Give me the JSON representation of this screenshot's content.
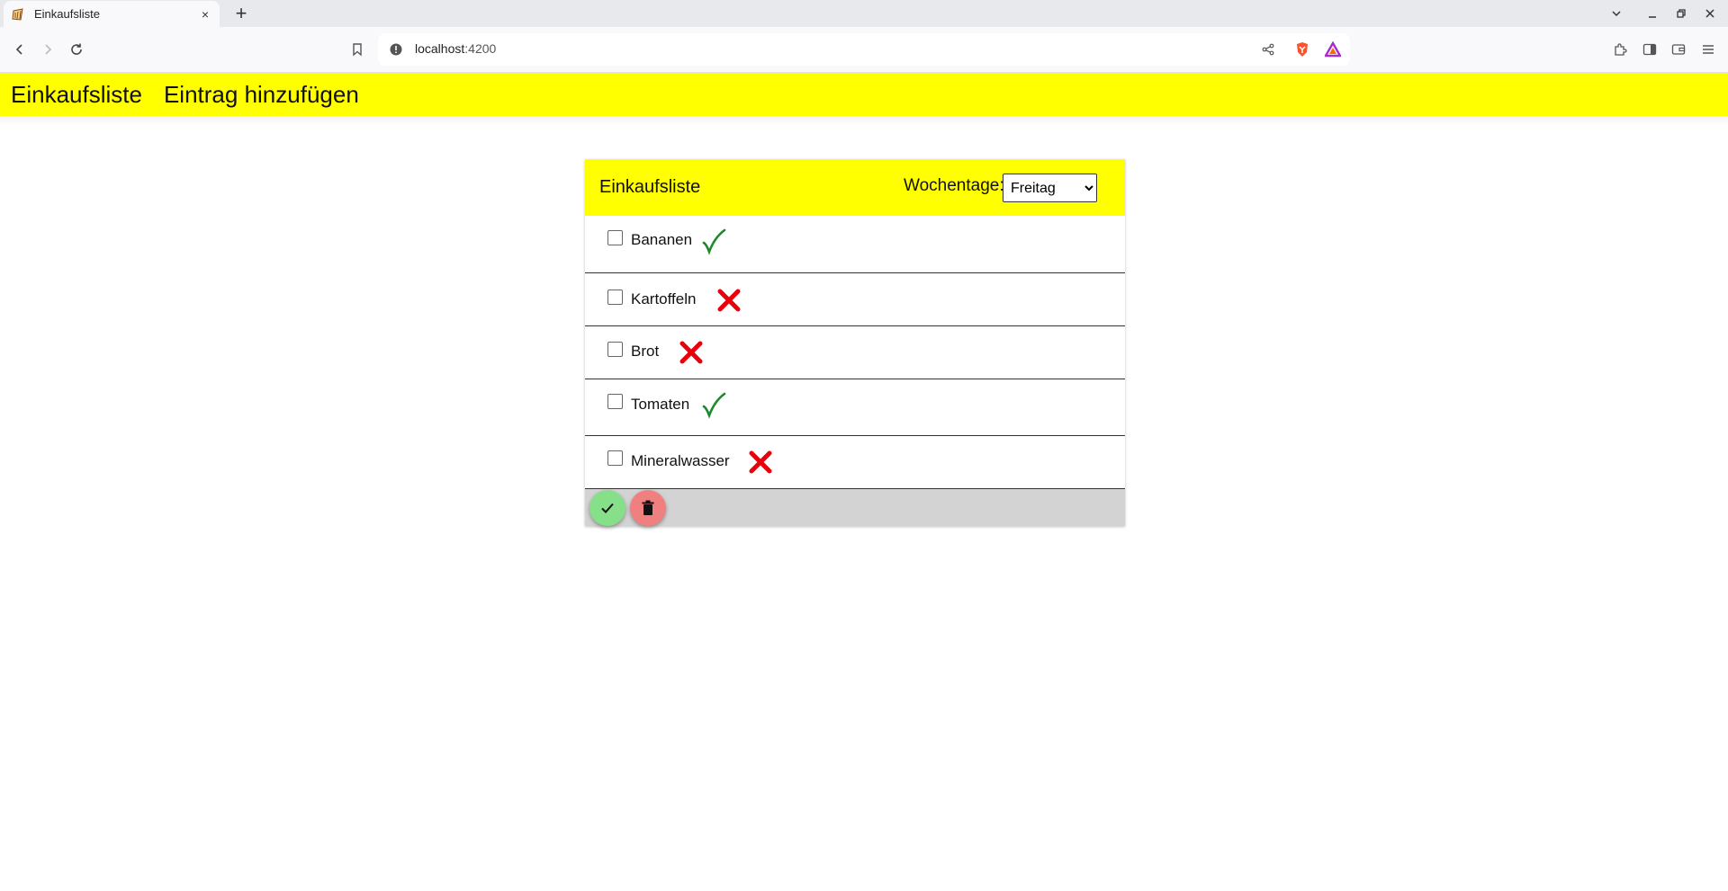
{
  "browser": {
    "tab_title": "Einkaufsliste",
    "tab_close": "×",
    "new_tab": "+",
    "url_host": "localhost",
    "url_port": ":4200"
  },
  "appnav": {
    "links": [
      "Einkaufsliste",
      "Eintrag hinzufügen"
    ]
  },
  "card": {
    "title": "Einkaufsliste",
    "weekday_label": "Wochentage:",
    "weekday_selected": "Freitag",
    "items": [
      {
        "name": "Bananen",
        "status": "check-icon"
      },
      {
        "name": "Kartoffeln",
        "status": "cross-icon"
      },
      {
        "name": "Brot",
        "status": "cross-icon"
      },
      {
        "name": "Tomaten",
        "status": "check-icon"
      },
      {
        "name": "Mineralwasser",
        "status": "cross-icon"
      }
    ],
    "footer": {
      "confirm_icon": "checkmark-icon",
      "delete_icon": "trash-icon"
    }
  },
  "colors": {
    "accent": "#ffff00",
    "check": "#1a8a2a",
    "cross": "#e8000b",
    "confirm_fab": "#86e08a",
    "delete_fab": "#f08080",
    "footer": "#d3d3d3"
  }
}
